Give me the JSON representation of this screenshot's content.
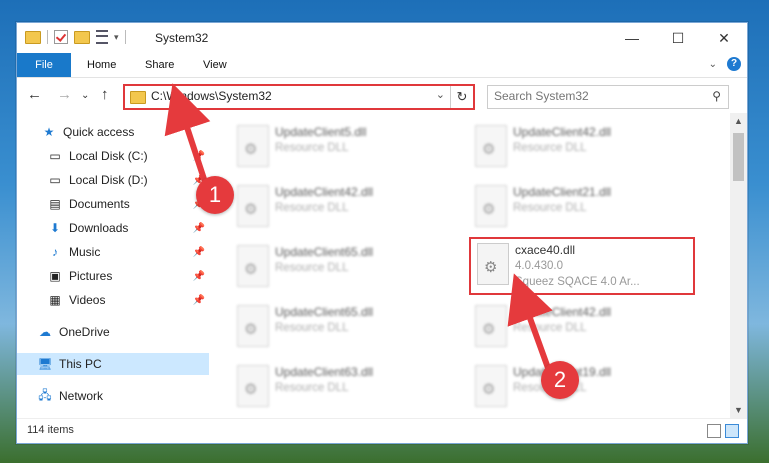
{
  "window": {
    "title": "System32",
    "controls": {
      "minimize": "—",
      "maximize": "☐",
      "close": "✕"
    }
  },
  "ribbon": {
    "tabs": [
      "File",
      "Home",
      "Share",
      "View"
    ],
    "help_label": "?"
  },
  "address": {
    "path": "C:\\Windows\\System32",
    "search_placeholder": "Search System32"
  },
  "nav": {
    "items": [
      {
        "label": "Quick access",
        "icon": "star-icon",
        "pinned": false
      },
      {
        "label": "Local Disk (C:)",
        "icon": "drive-icon",
        "pinned": true
      },
      {
        "label": "Local Disk (D:)",
        "icon": "drive-icon",
        "pinned": true
      },
      {
        "label": "Documents",
        "icon": "document-icon",
        "pinned": true
      },
      {
        "label": "Downloads",
        "icon": "download-icon",
        "pinned": true
      },
      {
        "label": "Music",
        "icon": "music-icon",
        "pinned": true
      },
      {
        "label": "Pictures",
        "icon": "picture-icon",
        "pinned": true
      },
      {
        "label": "Videos",
        "icon": "video-icon",
        "pinned": true
      },
      {
        "label": "OneDrive",
        "icon": "cloud-icon",
        "pinned": false
      },
      {
        "label": "This PC",
        "icon": "computer-icon",
        "pinned": false,
        "selected": true
      },
      {
        "label": "Network",
        "icon": "network-icon",
        "pinned": false
      }
    ]
  },
  "files": [
    {
      "name": "UpdateClient5.dll",
      "desc": "Resource DLL"
    },
    {
      "name": "UpdateClient42.dll",
      "desc": "Resource DLL"
    },
    {
      "name": "UpdateClient42.dll",
      "desc": "Resource DLL"
    },
    {
      "name": "UpdateClient21.dll",
      "desc": "Resource DLL"
    },
    {
      "name": "UpdateClient65.dll",
      "desc": "Resource DLL"
    },
    {
      "name": "cxace40.dll",
      "desc": "4.0.430.0",
      "desc2": "Squeez SQACE 4.0 Ar..."
    },
    {
      "name": "UpdateClient65.dll",
      "desc": "Resource DLL"
    },
    {
      "name": "UpdateClient42.dll",
      "desc": "Resource DLL"
    },
    {
      "name": "UpdateClient63.dll",
      "desc": "Resource DLL"
    },
    {
      "name": "UpdateClient19.dll",
      "desc": "Resource DLL"
    }
  ],
  "status": {
    "item_count": "114 items"
  },
  "annotations": {
    "step1": "1",
    "step2": "2",
    "color": "#e53a3d"
  }
}
